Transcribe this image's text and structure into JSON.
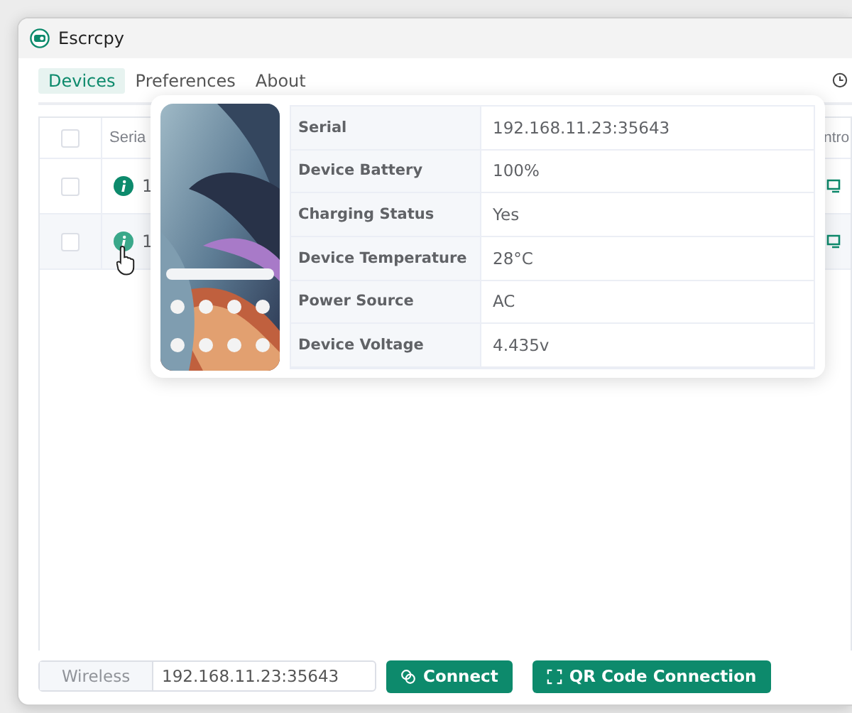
{
  "window": {
    "title": "Escrcpy"
  },
  "tabs": [
    {
      "label": "Devices",
      "selected": true
    },
    {
      "label": "Preferences",
      "selected": false
    },
    {
      "label": "About",
      "selected": false
    }
  ],
  "device_table": {
    "select_all": {
      "checked": false
    },
    "columns": [
      "Seria",
      "ntro"
    ],
    "rows": [
      {
        "checked": false,
        "serial": "1",
        "hovered": false
      },
      {
        "checked": false,
        "serial": "1",
        "hovered": true
      }
    ]
  },
  "device_info": {
    "fields": [
      {
        "label": "Serial",
        "value": "192.168.11.23:35643"
      },
      {
        "label": "Device Battery",
        "value": "100%"
      },
      {
        "label": "Charging Status",
        "value": "Yes"
      },
      {
        "label": "Device Temperature",
        "value": "28°C"
      },
      {
        "label": "Power Source",
        "value": "AC"
      },
      {
        "label": "Device Voltage",
        "value": "4.435v"
      }
    ]
  },
  "wireless": {
    "label": "Wireless",
    "value": "192.168.11.23:35643"
  },
  "buttons": [
    {
      "kind": "connect",
      "label": "Connect"
    },
    {
      "kind": "qr",
      "label": "QR Code Connection"
    }
  ]
}
